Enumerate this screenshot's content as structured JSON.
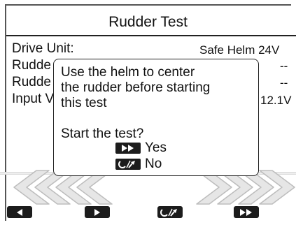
{
  "screen": {
    "title": "Rudder Test",
    "rows": [
      {
        "label": "Drive Unit:",
        "value": "Safe Helm 24V"
      },
      {
        "label": "Rudde",
        "value": "--"
      },
      {
        "label": "Rudde",
        "value": "--"
      },
      {
        "label": "Input V",
        "value": "12.1V"
      }
    ]
  },
  "dialog": {
    "message": "Use the helm to center\nthe rudder before starting\nthis test",
    "prompt": "Start the test?",
    "yes_label": "Yes",
    "no_label": "No"
  },
  "softkeys": [
    {
      "icon": "left-arrow-icon"
    },
    {
      "icon": "right-arrow-icon"
    },
    {
      "icon": "steering-cancel-icon"
    },
    {
      "icon": "fast-forward-icon"
    }
  ],
  "colors": {
    "key_fill": "#1c1c1c",
    "arrow_fill": "#e6e6e6",
    "arrow_stroke": "#bdbdbd"
  }
}
